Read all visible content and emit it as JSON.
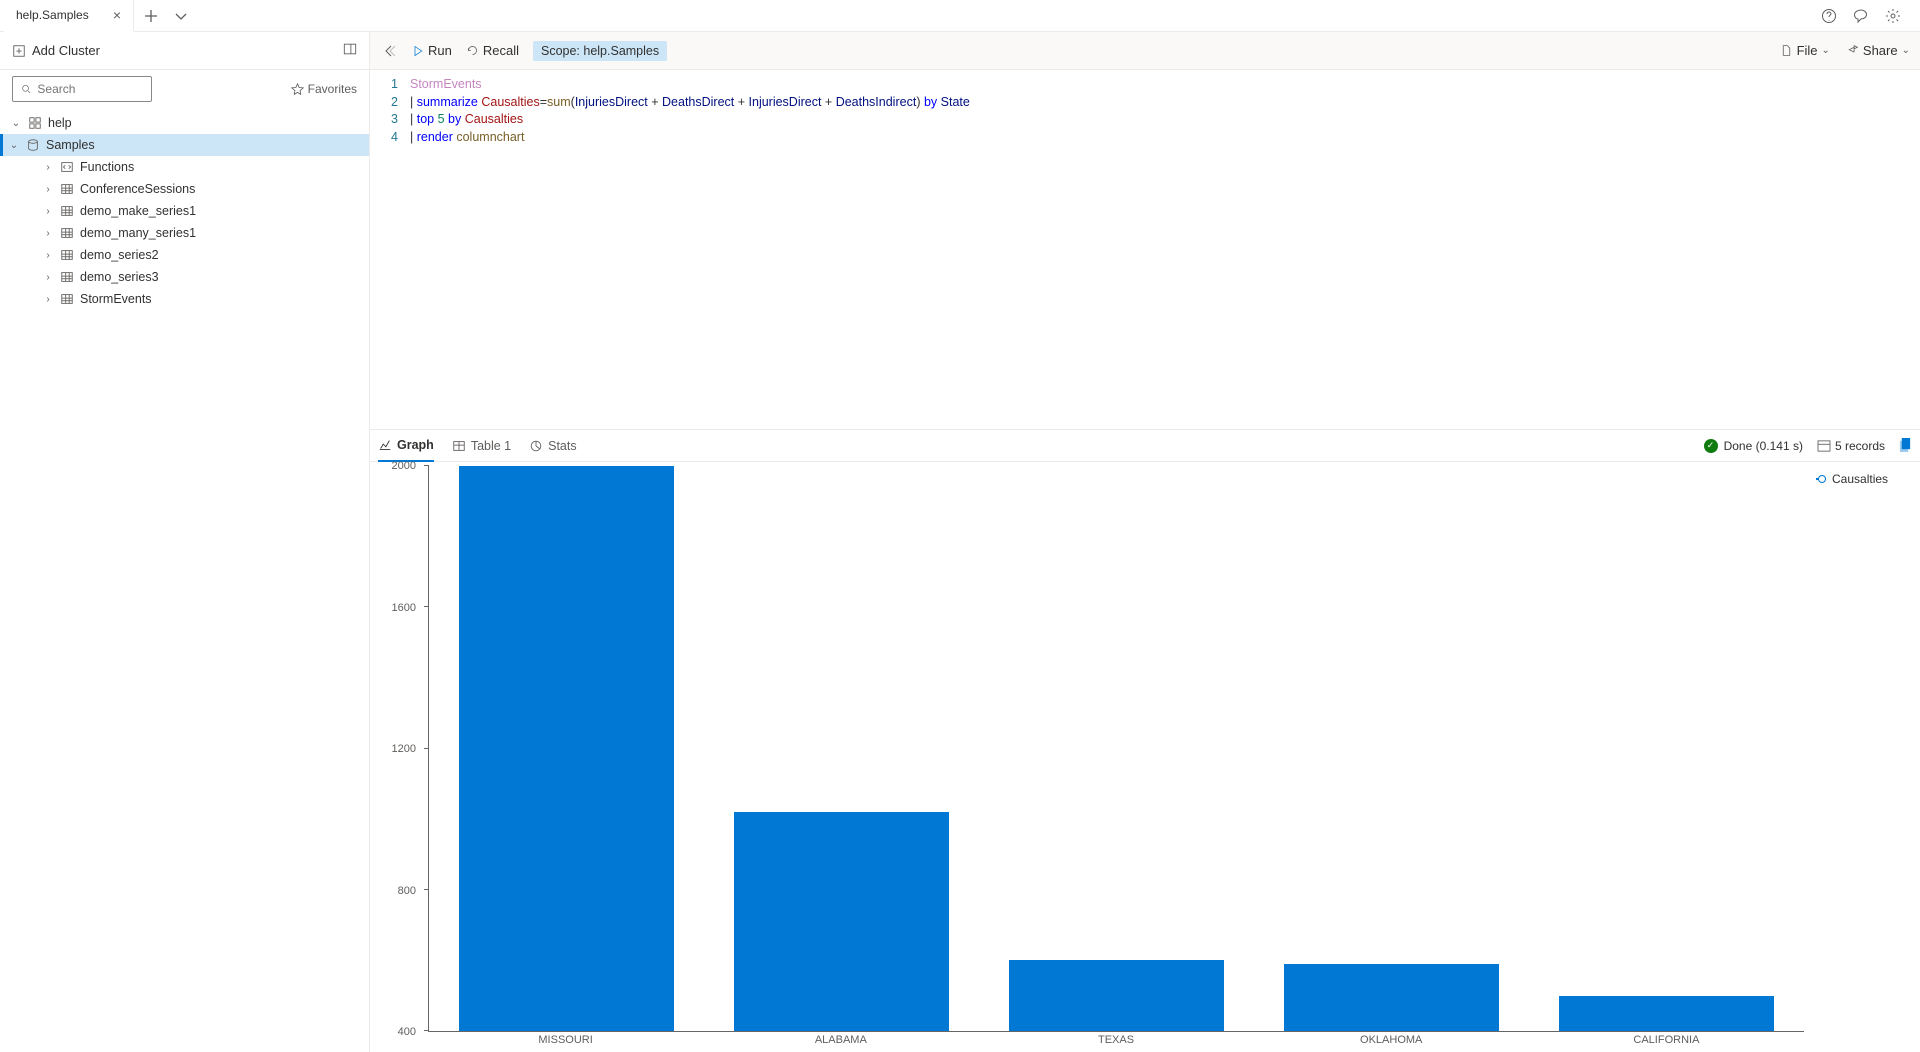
{
  "tabs": {
    "active_label": "help.Samples"
  },
  "header_icons": {
    "help": "help-icon",
    "feedback": "feedback-icon",
    "settings": "settings-icon"
  },
  "sidebar": {
    "add_cluster": "Add Cluster",
    "search_placeholder": "Search",
    "favorites_label": "Favorites",
    "tree": [
      {
        "label": "help",
        "depth": 0,
        "expanded": true,
        "icon": "cluster",
        "selected": false
      },
      {
        "label": "Samples",
        "depth": 1,
        "expanded": true,
        "icon": "database",
        "selected": true
      },
      {
        "label": "Functions",
        "depth": 2,
        "expanded": false,
        "icon": "function",
        "selected": false
      },
      {
        "label": "ConferenceSessions",
        "depth": 2,
        "expanded": false,
        "icon": "table",
        "selected": false
      },
      {
        "label": "demo_make_series1",
        "depth": 2,
        "expanded": false,
        "icon": "table",
        "selected": false
      },
      {
        "label": "demo_many_series1",
        "depth": 2,
        "expanded": false,
        "icon": "table",
        "selected": false
      },
      {
        "label": "demo_series2",
        "depth": 2,
        "expanded": false,
        "icon": "table",
        "selected": false
      },
      {
        "label": "demo_series3",
        "depth": 2,
        "expanded": false,
        "icon": "table",
        "selected": false
      },
      {
        "label": "StormEvents",
        "depth": 2,
        "expanded": false,
        "icon": "table",
        "selected": false
      }
    ]
  },
  "toolbar": {
    "run": "Run",
    "recall": "Recall",
    "scope": "Scope: help.Samples",
    "file": "File",
    "share": "Share"
  },
  "editor": {
    "lines": [
      {
        "n": "1",
        "tokens": [
          {
            "t": "StormEvents",
            "c": "kw-table"
          }
        ]
      },
      {
        "n": "2",
        "tokens": [
          {
            "t": "| ",
            "c": ""
          },
          {
            "t": "summarize",
            "c": "kw-op"
          },
          {
            "t": " ",
            "c": ""
          },
          {
            "t": "Causalties",
            "c": "kw-ident"
          },
          {
            "t": "=",
            "c": ""
          },
          {
            "t": "sum",
            "c": "kw-func"
          },
          {
            "t": "(",
            "c": ""
          },
          {
            "t": "InjuriesDirect",
            "c": "kw-col"
          },
          {
            "t": " + ",
            "c": ""
          },
          {
            "t": "DeathsDirect",
            "c": "kw-col"
          },
          {
            "t": " + ",
            "c": ""
          },
          {
            "t": "InjuriesDirect",
            "c": "kw-col"
          },
          {
            "t": " + ",
            "c": ""
          },
          {
            "t": "DeathsIndirect",
            "c": "kw-col"
          },
          {
            "t": ") ",
            "c": ""
          },
          {
            "t": "by",
            "c": "kw-op"
          },
          {
            "t": " ",
            "c": ""
          },
          {
            "t": "State",
            "c": "kw-col"
          }
        ]
      },
      {
        "n": "3",
        "tokens": [
          {
            "t": "| ",
            "c": ""
          },
          {
            "t": "top",
            "c": "kw-op"
          },
          {
            "t": " ",
            "c": ""
          },
          {
            "t": "5",
            "c": "kw-num"
          },
          {
            "t": " ",
            "c": ""
          },
          {
            "t": "by",
            "c": "kw-op"
          },
          {
            "t": " ",
            "c": ""
          },
          {
            "t": "Causalties",
            "c": "kw-ident"
          }
        ]
      },
      {
        "n": "4",
        "tokens": [
          {
            "t": "| ",
            "c": ""
          },
          {
            "t": "render",
            "c": "kw-op"
          },
          {
            "t": " ",
            "c": ""
          },
          {
            "t": "columnchart",
            "c": "kw-func"
          }
        ]
      }
    ]
  },
  "result_tabs": {
    "graph": "Graph",
    "table": "Table 1",
    "stats": "Stats"
  },
  "status": {
    "done": "Done (0.141 s)",
    "records": "5 records"
  },
  "legend": {
    "series": "Causalties"
  },
  "chart_data": {
    "type": "bar",
    "categories": [
      "MISSOURI",
      "ALABAMA",
      "TEXAS",
      "OKLAHOMA",
      "CALIFORNIA"
    ],
    "values": [
      2000,
      1020,
      600,
      590,
      500
    ],
    "title": "",
    "xlabel": "",
    "ylabel": "",
    "ylim": [
      400,
      2000
    ],
    "yticks": [
      400,
      800,
      1200,
      1600,
      2000
    ],
    "series_name": "Causalties"
  }
}
